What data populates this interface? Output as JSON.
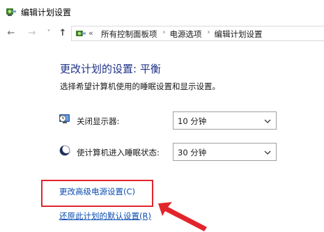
{
  "window": {
    "title": "编辑计划设置"
  },
  "nav": {
    "back_glyph": "←",
    "forward_glyph": "→",
    "dropdown_glyph": "˅",
    "up_glyph": "↑"
  },
  "address": {
    "lead": "«",
    "crumbs": [
      "所有控制面板项",
      "电源选项",
      "编辑计划设置"
    ],
    "separator": "›"
  },
  "main": {
    "title": "更改计划的设置: 平衡",
    "subtitle": "选择希望计算机使用的睡眠设置和显示设置。",
    "display_off_label": "关闭显示器:",
    "display_off_value": "10 分钟",
    "sleep_label": "使计算机进入睡眠状态:",
    "sleep_value": "30 分钟",
    "advanced_link": "更改高级电源设置(C)",
    "restore_link": "还原此计划的默认设置(R)"
  },
  "colors": {
    "title_blue": "#1e3287",
    "link_blue": "#0b4cb0",
    "annotation_red": "#e2242b"
  },
  "icons": {
    "app": "power-plan-icon",
    "display": "display-timer-icon",
    "sleep": "moon-sleep-icon"
  }
}
